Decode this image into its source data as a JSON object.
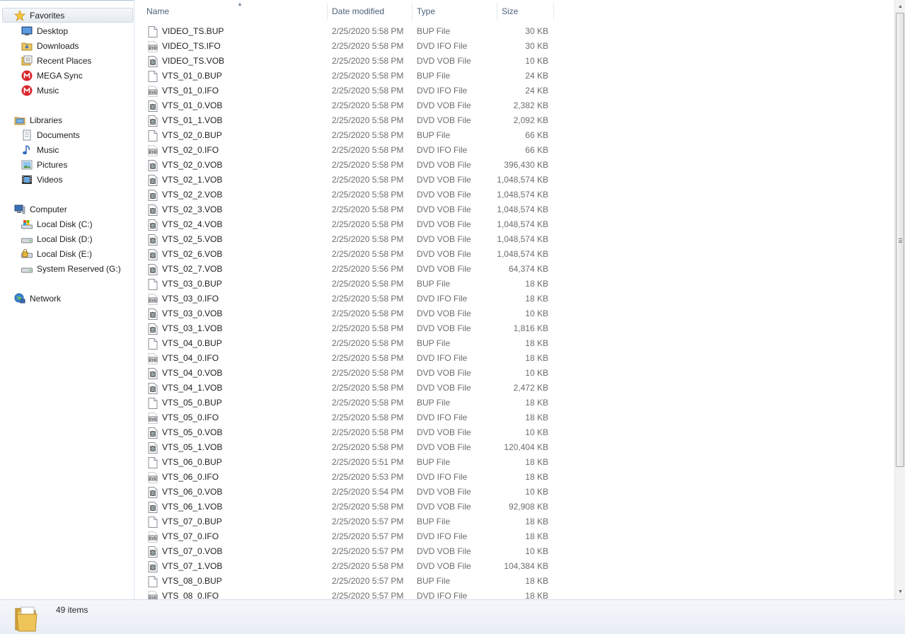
{
  "navigation": {
    "favorites": {
      "label": "Favorites",
      "icon": "star-icon",
      "items": [
        {
          "label": "Desktop",
          "icon": "desktop-icon"
        },
        {
          "label": "Downloads",
          "icon": "downloads-folder-icon"
        },
        {
          "label": "Recent Places",
          "icon": "recent-places-icon"
        },
        {
          "label": "MEGA Sync",
          "icon": "mega-icon"
        },
        {
          "label": "Music",
          "icon": "mega-icon"
        }
      ]
    },
    "libraries": {
      "label": "Libraries",
      "icon": "library-icon",
      "items": [
        {
          "label": "Documents",
          "icon": "documents-icon"
        },
        {
          "label": "Music",
          "icon": "music-note-icon"
        },
        {
          "label": "Pictures",
          "icon": "pictures-icon"
        },
        {
          "label": "Videos",
          "icon": "videos-icon"
        }
      ]
    },
    "computer": {
      "label": "Computer",
      "icon": "computer-icon",
      "items": [
        {
          "label": "Local Disk (C:)",
          "icon": "system-drive-icon"
        },
        {
          "label": "Local Disk (D:)",
          "icon": "drive-icon"
        },
        {
          "label": "Local Disk (E:)",
          "icon": "locked-drive-icon"
        },
        {
          "label": "System Reserved (G:)",
          "icon": "drive-icon"
        }
      ]
    },
    "network": {
      "label": "Network",
      "icon": "network-icon"
    }
  },
  "columns": {
    "name": "Name",
    "date": "Date modified",
    "type": "Type",
    "size": "Size",
    "sorted_by": "Name"
  },
  "files": [
    {
      "name": "VIDEO_TS.BUP",
      "date": "2/25/2020 5:58 PM",
      "type": "BUP File",
      "size": "30 KB",
      "icon": "blank-file-icon"
    },
    {
      "name": "VIDEO_TS.IFO",
      "date": "2/25/2020 5:58 PM",
      "type": "DVD IFO File",
      "size": "30 KB",
      "icon": "dvd-ifo-icon"
    },
    {
      "name": "VIDEO_TS.VOB",
      "date": "2/25/2020 5:58 PM",
      "type": "DVD VOB File",
      "size": "10 KB",
      "icon": "dvd-vob-icon"
    },
    {
      "name": "VTS_01_0.BUP",
      "date": "2/25/2020 5:58 PM",
      "type": "BUP File",
      "size": "24 KB",
      "icon": "blank-file-icon"
    },
    {
      "name": "VTS_01_0.IFO",
      "date": "2/25/2020 5:58 PM",
      "type": "DVD IFO File",
      "size": "24 KB",
      "icon": "dvd-ifo-icon"
    },
    {
      "name": "VTS_01_0.VOB",
      "date": "2/25/2020 5:58 PM",
      "type": "DVD VOB File",
      "size": "2,382 KB",
      "icon": "dvd-vob-icon"
    },
    {
      "name": "VTS_01_1.VOB",
      "date": "2/25/2020 5:58 PM",
      "type": "DVD VOB File",
      "size": "2,092 KB",
      "icon": "dvd-vob-icon"
    },
    {
      "name": "VTS_02_0.BUP",
      "date": "2/25/2020 5:58 PM",
      "type": "BUP File",
      "size": "66 KB",
      "icon": "blank-file-icon"
    },
    {
      "name": "VTS_02_0.IFO",
      "date": "2/25/2020 5:58 PM",
      "type": "DVD IFO File",
      "size": "66 KB",
      "icon": "dvd-ifo-icon"
    },
    {
      "name": "VTS_02_0.VOB",
      "date": "2/25/2020 5:58 PM",
      "type": "DVD VOB File",
      "size": "396,430 KB",
      "icon": "dvd-vob-icon"
    },
    {
      "name": "VTS_02_1.VOB",
      "date": "2/25/2020 5:58 PM",
      "type": "DVD VOB File",
      "size": "1,048,574 KB",
      "icon": "dvd-vob-icon"
    },
    {
      "name": "VTS_02_2.VOB",
      "date": "2/25/2020 5:58 PM",
      "type": "DVD VOB File",
      "size": "1,048,574 KB",
      "icon": "dvd-vob-icon"
    },
    {
      "name": "VTS_02_3.VOB",
      "date": "2/25/2020 5:58 PM",
      "type": "DVD VOB File",
      "size": "1,048,574 KB",
      "icon": "dvd-vob-icon"
    },
    {
      "name": "VTS_02_4.VOB",
      "date": "2/25/2020 5:58 PM",
      "type": "DVD VOB File",
      "size": "1,048,574 KB",
      "icon": "dvd-vob-icon"
    },
    {
      "name": "VTS_02_5.VOB",
      "date": "2/25/2020 5:58 PM",
      "type": "DVD VOB File",
      "size": "1,048,574 KB",
      "icon": "dvd-vob-icon"
    },
    {
      "name": "VTS_02_6.VOB",
      "date": "2/25/2020 5:58 PM",
      "type": "DVD VOB File",
      "size": "1,048,574 KB",
      "icon": "dvd-vob-icon"
    },
    {
      "name": "VTS_02_7.VOB",
      "date": "2/25/2020 5:56 PM",
      "type": "DVD VOB File",
      "size": "64,374 KB",
      "icon": "dvd-vob-icon"
    },
    {
      "name": "VTS_03_0.BUP",
      "date": "2/25/2020 5:58 PM",
      "type": "BUP File",
      "size": "18 KB",
      "icon": "blank-file-icon"
    },
    {
      "name": "VTS_03_0.IFO",
      "date": "2/25/2020 5:58 PM",
      "type": "DVD IFO File",
      "size": "18 KB",
      "icon": "dvd-ifo-icon"
    },
    {
      "name": "VTS_03_0.VOB",
      "date": "2/25/2020 5:58 PM",
      "type": "DVD VOB File",
      "size": "10 KB",
      "icon": "dvd-vob-icon"
    },
    {
      "name": "VTS_03_1.VOB",
      "date": "2/25/2020 5:58 PM",
      "type": "DVD VOB File",
      "size": "1,816 KB",
      "icon": "dvd-vob-icon"
    },
    {
      "name": "VTS_04_0.BUP",
      "date": "2/25/2020 5:58 PM",
      "type": "BUP File",
      "size": "18 KB",
      "icon": "blank-file-icon"
    },
    {
      "name": "VTS_04_0.IFO",
      "date": "2/25/2020 5:58 PM",
      "type": "DVD IFO File",
      "size": "18 KB",
      "icon": "dvd-ifo-icon"
    },
    {
      "name": "VTS_04_0.VOB",
      "date": "2/25/2020 5:58 PM",
      "type": "DVD VOB File",
      "size": "10 KB",
      "icon": "dvd-vob-icon"
    },
    {
      "name": "VTS_04_1.VOB",
      "date": "2/25/2020 5:58 PM",
      "type": "DVD VOB File",
      "size": "2,472 KB",
      "icon": "dvd-vob-icon"
    },
    {
      "name": "VTS_05_0.BUP",
      "date": "2/25/2020 5:58 PM",
      "type": "BUP File",
      "size": "18 KB",
      "icon": "blank-file-icon"
    },
    {
      "name": "VTS_05_0.IFO",
      "date": "2/25/2020 5:58 PM",
      "type": "DVD IFO File",
      "size": "18 KB",
      "icon": "dvd-ifo-icon"
    },
    {
      "name": "VTS_05_0.VOB",
      "date": "2/25/2020 5:58 PM",
      "type": "DVD VOB File",
      "size": "10 KB",
      "icon": "dvd-vob-icon"
    },
    {
      "name": "VTS_05_1.VOB",
      "date": "2/25/2020 5:58 PM",
      "type": "DVD VOB File",
      "size": "120,404 KB",
      "icon": "dvd-vob-icon"
    },
    {
      "name": "VTS_06_0.BUP",
      "date": "2/25/2020 5:51 PM",
      "type": "BUP File",
      "size": "18 KB",
      "icon": "blank-file-icon"
    },
    {
      "name": "VTS_06_0.IFO",
      "date": "2/25/2020 5:53 PM",
      "type": "DVD IFO File",
      "size": "18 KB",
      "icon": "dvd-ifo-icon"
    },
    {
      "name": "VTS_06_0.VOB",
      "date": "2/25/2020 5:54 PM",
      "type": "DVD VOB File",
      "size": "10 KB",
      "icon": "dvd-vob-icon"
    },
    {
      "name": "VTS_06_1.VOB",
      "date": "2/25/2020 5:58 PM",
      "type": "DVD VOB File",
      "size": "92,908 KB",
      "icon": "dvd-vob-icon"
    },
    {
      "name": "VTS_07_0.BUP",
      "date": "2/25/2020 5:57 PM",
      "type": "BUP File",
      "size": "18 KB",
      "icon": "blank-file-icon"
    },
    {
      "name": "VTS_07_0.IFO",
      "date": "2/25/2020 5:57 PM",
      "type": "DVD IFO File",
      "size": "18 KB",
      "icon": "dvd-ifo-icon"
    },
    {
      "name": "VTS_07_0.VOB",
      "date": "2/25/2020 5:57 PM",
      "type": "DVD VOB File",
      "size": "10 KB",
      "icon": "dvd-vob-icon"
    },
    {
      "name": "VTS_07_1.VOB",
      "date": "2/25/2020 5:58 PM",
      "type": "DVD VOB File",
      "size": "104,384 KB",
      "icon": "dvd-vob-icon"
    },
    {
      "name": "VTS_08_0.BUP",
      "date": "2/25/2020 5:57 PM",
      "type": "BUP File",
      "size": "18 KB",
      "icon": "blank-file-icon"
    },
    {
      "name": "VTS_08_0.IFO",
      "date": "2/25/2020 5:57 PM",
      "type": "DVD IFO File",
      "size": "18 KB",
      "icon": "dvd-ifo-icon"
    }
  ],
  "status": {
    "item_count": "49 items",
    "icon": "folder-icon"
  },
  "scrollbar": {
    "position": 0.0,
    "visible_fraction": 0.78
  }
}
